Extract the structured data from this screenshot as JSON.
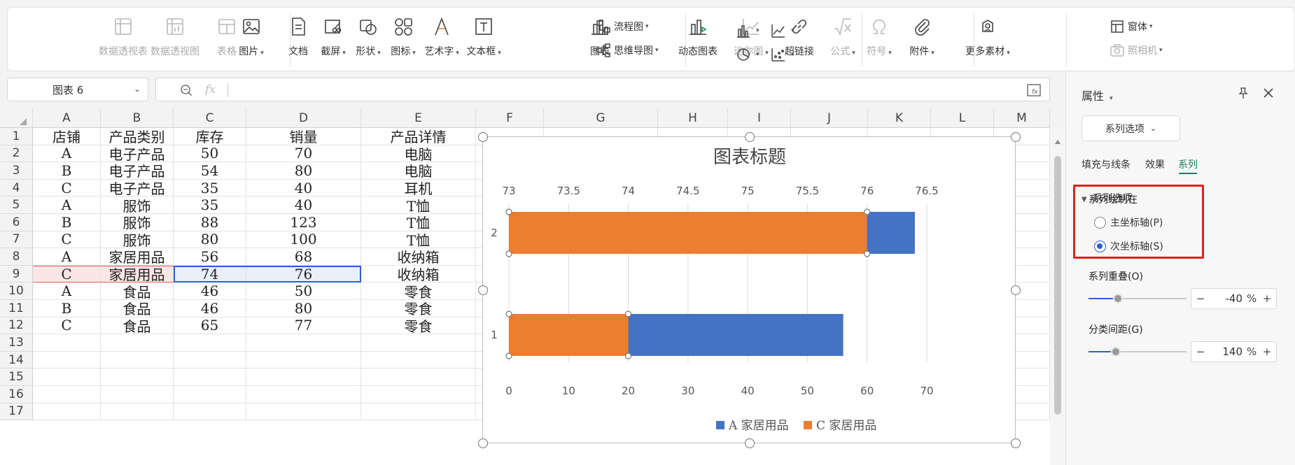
{
  "ribbon": {
    "tools": [
      {
        "name": "pivot-table-tool",
        "label": "数据透视表",
        "disabled": true
      },
      {
        "name": "pivot-chart-tool",
        "label": "数据透视图",
        "disabled": true
      },
      {
        "name": "table-tool",
        "label": "表格",
        "disabled": true
      },
      {
        "name": "picture-tool",
        "label": "图片",
        "caret": true
      },
      {
        "name": "document-tool",
        "label": "文档"
      },
      {
        "name": "screenshot-tool",
        "label": "截屏",
        "caret": true
      },
      {
        "name": "shape-tool",
        "label": "形状",
        "caret": true
      },
      {
        "name": "icon-tool",
        "label": "图标",
        "caret": true
      },
      {
        "name": "wordart-tool",
        "label": "艺术字",
        "caret": true
      },
      {
        "name": "textbox-tool",
        "label": "文本框",
        "caret": true
      },
      {
        "name": "chart-tool",
        "label": "图表"
      },
      {
        "name": "dynamic-chart-tool",
        "label": "动态图表"
      },
      {
        "name": "sparkline-tool",
        "label": "迷你图",
        "caret": true,
        "disabled": true
      },
      {
        "name": "hyperlink-tool",
        "label": "超链接"
      },
      {
        "name": "formula-tool",
        "label": "公式",
        "caret": true,
        "disabled": true
      },
      {
        "name": "symbol-tool",
        "label": "符号",
        "caret": true,
        "disabled": true
      },
      {
        "name": "attachment-tool",
        "label": "附件",
        "caret": true
      },
      {
        "name": "more-materials-tool",
        "label": "更多素材",
        "caret": true
      }
    ],
    "small": {
      "flowchart": "流程图",
      "mindmap": "思维导图",
      "window": "窗体",
      "camera": "照相机"
    }
  },
  "namebox": {
    "value": "图表 6"
  },
  "formula": {
    "fx": "fx",
    "value": ""
  },
  "sheet": {
    "columns": [
      "A",
      "B",
      "C",
      "D",
      "E",
      "F",
      "G",
      "H",
      "I",
      "J",
      "K",
      "L",
      "M"
    ],
    "rows": [
      "1",
      "2",
      "3",
      "4",
      "5",
      "6",
      "7",
      "8",
      "9",
      "10",
      "11",
      "12",
      "13",
      "14",
      "15",
      "16",
      "17"
    ],
    "header": [
      "店铺",
      "产品类别",
      "库存",
      "销量",
      "产品详情"
    ],
    "data": [
      [
        "A",
        "电子产品",
        "50",
        "70",
        "电脑"
      ],
      [
        "B",
        "电子产品",
        "54",
        "80",
        "电脑"
      ],
      [
        "C",
        "电子产品",
        "35",
        "40",
        "耳机"
      ],
      [
        "A",
        "服饰",
        "35",
        "40",
        "T恤"
      ],
      [
        "B",
        "服饰",
        "88",
        "123",
        "T恤"
      ],
      [
        "C",
        "服饰",
        "80",
        "100",
        "T恤"
      ],
      [
        "A",
        "家居用品",
        "56",
        "68",
        "收纳箱"
      ],
      [
        "C",
        "家居用品",
        "74",
        "76",
        "收纳箱"
      ],
      [
        "A",
        "食品",
        "46",
        "50",
        "零食"
      ],
      [
        "B",
        "食品",
        "46",
        "80",
        "零食"
      ],
      [
        "C",
        "食品",
        "65",
        "77",
        "零食"
      ]
    ]
  },
  "chart_data": {
    "type": "bar",
    "title": "图表标题",
    "orientation": "horizontal",
    "categories": [
      "1",
      "2"
    ],
    "series": [
      {
        "name": "A 家居用品",
        "values": [
          56,
          68
        ],
        "axis": "primary",
        "color": "#4472c4"
      },
      {
        "name": "C 家居用品",
        "values": [
          74,
          76
        ],
        "axis": "secondary",
        "color": "#ed7d31"
      }
    ],
    "primary_axis": {
      "min": 0,
      "max": 70,
      "ticks": [
        "0",
        "10",
        "20",
        "30",
        "40",
        "50",
        "60",
        "70"
      ],
      "position": "bottom"
    },
    "secondary_axis": {
      "min": 73,
      "max": 76.5,
      "ticks": [
        "73",
        "73.5",
        "74",
        "74.5",
        "75",
        "75.5",
        "76",
        "76.5"
      ],
      "position": "top"
    },
    "grid": true,
    "legend": "bottom"
  },
  "panel": {
    "title": "属性",
    "series_dropdown": "系列选项",
    "tabs": [
      "填充与线条",
      "效果",
      "系列"
    ],
    "active_tab": "系列",
    "section": "系列选项",
    "plot_on_label": "系列绘制在",
    "radio_primary": "主坐标轴(P)",
    "radio_secondary": "次坐标轴(S)",
    "selected_axis": "secondary",
    "overlap_label": "系列重叠(O)",
    "overlap_value": "-40",
    "overlap_fraction": 0.3,
    "gap_label": "分类间距(G)",
    "gap_value": "140",
    "gap_fraction": 0.28,
    "unit": "%",
    "minus": "−",
    "plus": "+"
  }
}
